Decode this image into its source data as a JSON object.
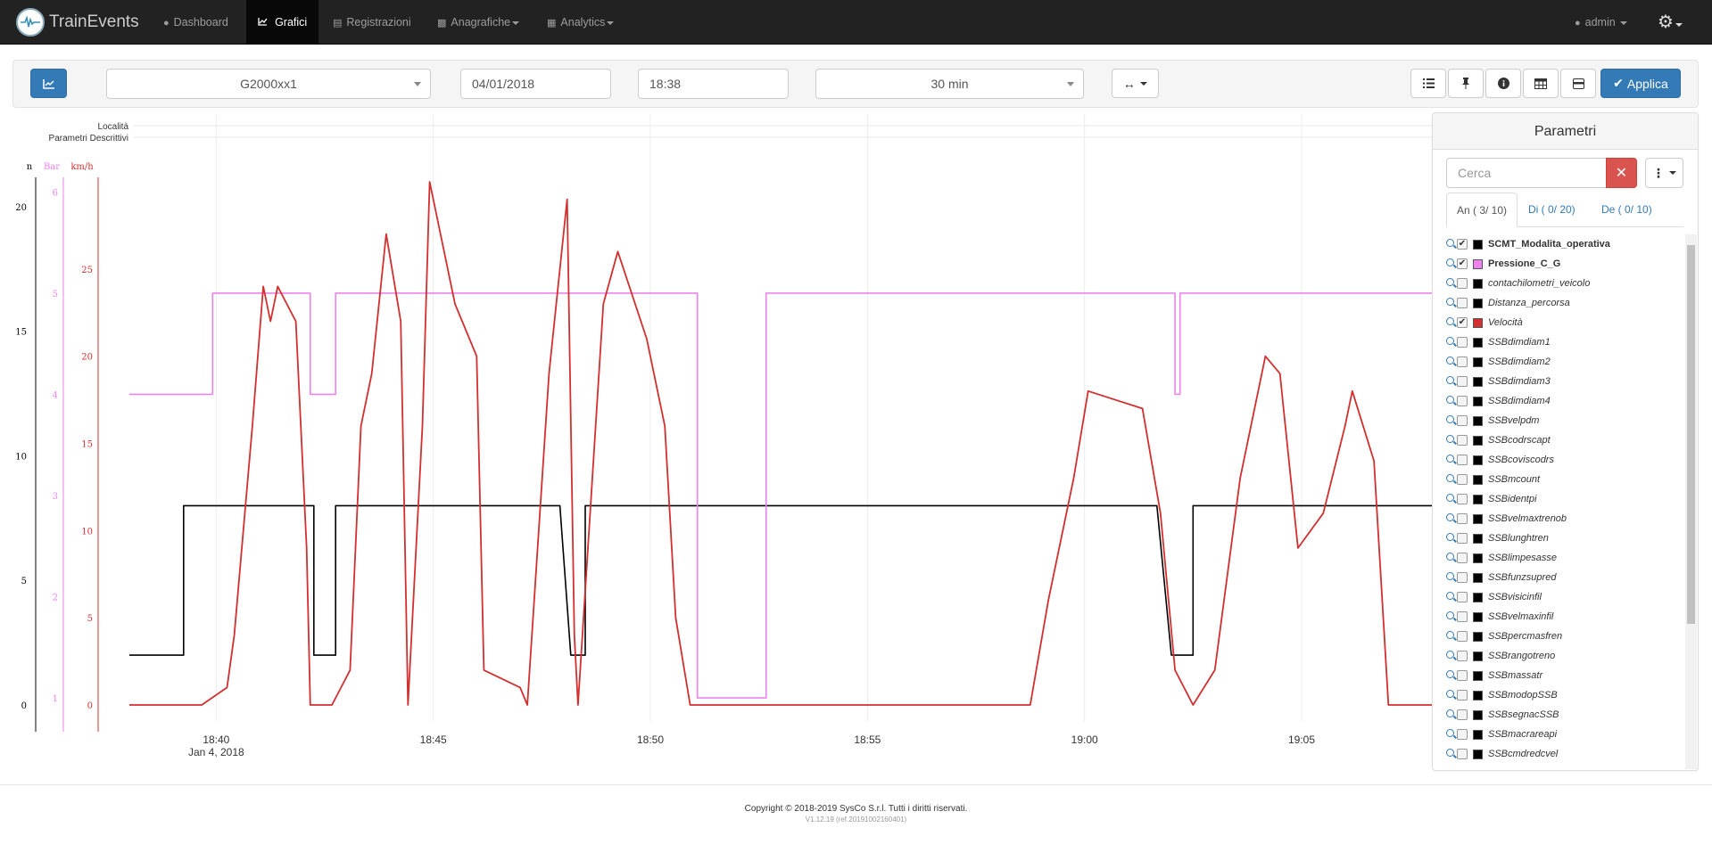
{
  "app": {
    "brand": "TrainEvents"
  },
  "nav": {
    "items": [
      {
        "label": "Dashboard",
        "icon": "map-marker-icon"
      },
      {
        "label": "Grafici",
        "icon": "line-chart-icon"
      },
      {
        "label": "Registrazioni",
        "icon": "file-icon"
      },
      {
        "label": "Anagrafiche",
        "icon": "book-icon"
      },
      {
        "label": "Analytics",
        "icon": "grid-icon"
      }
    ],
    "user": "admin"
  },
  "toolbar": {
    "vehicle": "G2000xx1",
    "date": "04/01/2018",
    "time": "18:38",
    "duration": "30 min",
    "apply_label": "Applica"
  },
  "chart": {
    "band_labels": [
      "Località",
      "Parametri Descrittivi"
    ],
    "axis_units": {
      "n": "n",
      "bar": "Bar",
      "kmh": "km/h"
    },
    "x_ticks": [
      "18:40",
      "18:45",
      "18:50",
      "18:55",
      "19:00",
      "19:05"
    ],
    "x_date": "Jan 4, 2018",
    "colors": {
      "n": "#000000",
      "bar": "#ee82ee",
      "kmh": "#d32f2f"
    }
  },
  "chart_data": {
    "type": "line",
    "x_range": [
      "18:38",
      "19:08"
    ],
    "axes": [
      {
        "name": "n",
        "range": [
          0,
          21
        ],
        "ticks": [
          0,
          5,
          10,
          15,
          20
        ]
      },
      {
        "name": "Bar",
        "range": [
          0.93,
          6.1
        ],
        "ticks": [
          1,
          2,
          3,
          4,
          5,
          6
        ]
      },
      {
        "name": "km/h",
        "range": [
          0,
          30
        ],
        "ticks": [
          0,
          5,
          10,
          15,
          20,
          25
        ]
      }
    ],
    "series": [
      {
        "name": "SCMT_Modalita_operativa",
        "axis": "n",
        "points": [
          [
            "18:38:00",
            2
          ],
          [
            "18:39:15",
            2
          ],
          [
            "18:39:15",
            8
          ],
          [
            "18:42:15",
            8
          ],
          [
            "18:42:15",
            2
          ],
          [
            "18:42:45",
            2
          ],
          [
            "18:42:45",
            8
          ],
          [
            "18:47:55",
            8
          ],
          [
            "18:48:10",
            2
          ],
          [
            "18:48:30",
            2
          ],
          [
            "18:48:30",
            8
          ],
          [
            "19:01:40",
            8
          ],
          [
            "19:02:00",
            2
          ],
          [
            "19:02:30",
            2
          ],
          [
            "19:02:30",
            8
          ],
          [
            "19:08:00",
            8
          ]
        ]
      },
      {
        "name": "Pressione_C_G",
        "axis": "Bar",
        "points": [
          [
            "18:38:00",
            4
          ],
          [
            "18:39:55",
            4
          ],
          [
            "18:39:55",
            5
          ],
          [
            "18:42:10",
            5
          ],
          [
            "18:42:10",
            4
          ],
          [
            "18:42:45",
            4
          ],
          [
            "18:42:45",
            5
          ],
          [
            "18:51:05",
            5
          ],
          [
            "18:51:05",
            1
          ],
          [
            "18:52:40",
            1
          ],
          [
            "18:52:40",
            5
          ],
          [
            "19:02:05",
            5
          ],
          [
            "19:02:05",
            4
          ],
          [
            "19:02:12",
            4
          ],
          [
            "19:02:12",
            5
          ],
          [
            "19:04:50",
            5
          ],
          [
            "19:08:00",
            5
          ]
        ]
      },
      {
        "name": "Velocità",
        "axis": "km/h",
        "points": [
          [
            "18:38:00",
            0
          ],
          [
            "18:39:40",
            0
          ],
          [
            "18:40:15",
            1
          ],
          [
            "18:40:25",
            4
          ],
          [
            "18:40:50",
            16
          ],
          [
            "18:41:05",
            24
          ],
          [
            "18:41:15",
            22
          ],
          [
            "18:41:25",
            24
          ],
          [
            "18:41:50",
            22
          ],
          [
            "18:42:05",
            9
          ],
          [
            "18:42:10",
            0
          ],
          [
            "18:42:40",
            0
          ],
          [
            "18:43:05",
            2
          ],
          [
            "18:43:20",
            16
          ],
          [
            "18:43:35",
            19
          ],
          [
            "18:43:55",
            27
          ],
          [
            "18:44:15",
            22
          ],
          [
            "18:44:25",
            0
          ],
          [
            "18:44:45",
            16
          ],
          [
            "18:44:55",
            30
          ],
          [
            "18:45:30",
            23
          ],
          [
            "18:46:00",
            20
          ],
          [
            "18:46:10",
            2
          ],
          [
            "18:47:00",
            1
          ],
          [
            "18:47:10",
            0
          ],
          [
            "18:47:40",
            19
          ],
          [
            "18:48:05",
            29
          ],
          [
            "18:48:15",
            4
          ],
          [
            "18:48:20",
            0
          ],
          [
            "18:48:55",
            23
          ],
          [
            "18:49:15",
            26
          ],
          [
            "18:49:55",
            21
          ],
          [
            "18:50:20",
            16
          ],
          [
            "18:50:35",
            5
          ],
          [
            "18:50:55",
            0
          ],
          [
            "18:58:45",
            0
          ],
          [
            "18:59:10",
            6
          ],
          [
            "18:59:45",
            13
          ],
          [
            "19:00:05",
            18
          ],
          [
            "19:01:20",
            17
          ],
          [
            "19:01:45",
            11
          ],
          [
            "19:02:05",
            2
          ],
          [
            "19:02:30",
            0
          ],
          [
            "19:03:00",
            2
          ],
          [
            "19:03:35",
            13
          ],
          [
            "19:04:10",
            20
          ],
          [
            "19:04:30",
            19
          ],
          [
            "19:04:55",
            9
          ],
          [
            "19:05:30",
            11
          ],
          [
            "19:06:00",
            16
          ],
          [
            "19:06:10",
            18
          ],
          [
            "19:06:40",
            14
          ],
          [
            "19:07:00",
            0
          ],
          [
            "19:08:00",
            0
          ]
        ]
      }
    ]
  },
  "panel": {
    "title": "Parametri",
    "search_placeholder": "Cerca",
    "tabs": [
      "An ( 3/ 10)",
      "Di ( 0/ 20)",
      "De ( 0/ 10)"
    ],
    "params": [
      {
        "name": "SCMT_Modalita_operativa",
        "checked": true,
        "color": "#000000",
        "bold": true
      },
      {
        "name": "Pressione_C_G",
        "checked": true,
        "color": "#ee82ee",
        "bold": true
      },
      {
        "name": "contachilometri_veicolo",
        "checked": false,
        "color": "#000000",
        "bold": false
      },
      {
        "name": "Distanza_percorsa",
        "checked": false,
        "color": "#000000",
        "bold": false
      },
      {
        "name": "Velocità",
        "checked": true,
        "color": "#d32f2f",
        "bold": false
      },
      {
        "name": "SSBdimdiam1",
        "checked": false,
        "color": "#000000",
        "bold": false
      },
      {
        "name": "SSBdimdiam2",
        "checked": false,
        "color": "#000000",
        "bold": false
      },
      {
        "name": "SSBdimdiam3",
        "checked": false,
        "color": "#000000",
        "bold": false
      },
      {
        "name": "SSBdimdiam4",
        "checked": false,
        "color": "#000000",
        "bold": false
      },
      {
        "name": "SSBvelpdm",
        "checked": false,
        "color": "#000000",
        "bold": false
      },
      {
        "name": "SSBcodrscapt",
        "checked": false,
        "color": "#000000",
        "bold": false
      },
      {
        "name": "SSBcoviscodrs",
        "checked": false,
        "color": "#000000",
        "bold": false
      },
      {
        "name": "SSBmcount",
        "checked": false,
        "color": "#000000",
        "bold": false
      },
      {
        "name": "SSBidentpi",
        "checked": false,
        "color": "#000000",
        "bold": false
      },
      {
        "name": "SSBvelmaxtrenob",
        "checked": false,
        "color": "#000000",
        "bold": false
      },
      {
        "name": "SSBlunghtren",
        "checked": false,
        "color": "#000000",
        "bold": false
      },
      {
        "name": "SSBlimpesasse",
        "checked": false,
        "color": "#000000",
        "bold": false
      },
      {
        "name": "SSBfunzsupred",
        "checked": false,
        "color": "#000000",
        "bold": false
      },
      {
        "name": "SSBvisicinfil",
        "checked": false,
        "color": "#000000",
        "bold": false
      },
      {
        "name": "SSBvelmaxinfil",
        "checked": false,
        "color": "#000000",
        "bold": false
      },
      {
        "name": "SSBpercmasfren",
        "checked": false,
        "color": "#000000",
        "bold": false
      },
      {
        "name": "SSBrangotreno",
        "checked": false,
        "color": "#000000",
        "bold": false
      },
      {
        "name": "SSBmassatr",
        "checked": false,
        "color": "#000000",
        "bold": false
      },
      {
        "name": "SSBmodopSSB",
        "checked": false,
        "color": "#000000",
        "bold": false
      },
      {
        "name": "SSBsegnacSSB",
        "checked": false,
        "color": "#000000",
        "bold": false
      },
      {
        "name": "SSBmacrareapi",
        "checked": false,
        "color": "#000000",
        "bold": false
      },
      {
        "name": "SSBcmdredcvel",
        "checked": false,
        "color": "#000000",
        "bold": false
      }
    ]
  },
  "footer": {
    "copyright": "Copyright © 2018-2019 SysCo S.r.l. Tutti i diritti riservati.",
    "version": "V1.12.19 (ref.20191002160401)"
  }
}
